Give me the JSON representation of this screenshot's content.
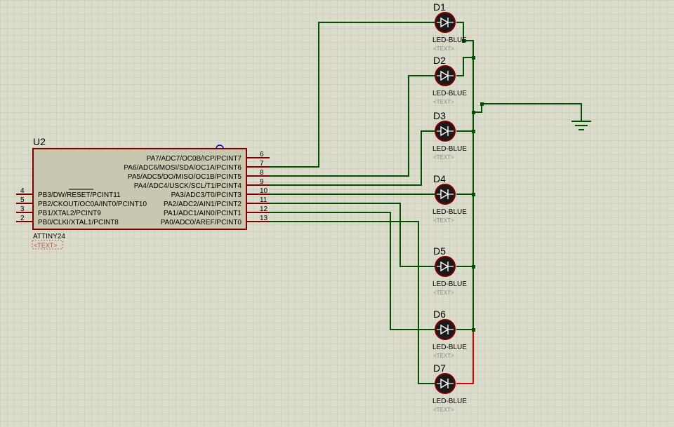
{
  "chip": {
    "ref": "U2",
    "part": "ATTINY24",
    "text": "<TEXT>",
    "right_pins": [
      {
        "label": "PA7/ADC7/OC0B/ICP/PCINT7",
        "num": "6"
      },
      {
        "label": "PA6/ADC6/MOSI/SDA/OC1A/PCINT6",
        "num": "7"
      },
      {
        "label": "PA5/ADC5/DO/MISO/OC1B/PCINT5",
        "num": "8"
      },
      {
        "label": "PA4/ADC4/USCK/SCL/T1/PCINT4",
        "num": "9"
      },
      {
        "label": "PA3/ADC3/T0/PCINT3",
        "num": "10"
      },
      {
        "label": "PA2/ADC2/AIN1/PCINT2",
        "num": "11"
      },
      {
        "label": "PA1/ADC1/AIN0/PCINT1",
        "num": "12"
      },
      {
        "label": "PA0/ADC0/AREF/PCINT0",
        "num": "13"
      }
    ],
    "left_pins": [
      {
        "label": "PB3/DW/RESET/PCINT11",
        "num": "4"
      },
      {
        "label": "PB2/CKOUT/OC0A/INT0/PCINT10",
        "num": "5"
      },
      {
        "label": "PB1/XTAL2/PCINT9",
        "num": "3"
      },
      {
        "label": "PB0/CLKI/XTAL1/PCINT8",
        "num": "2"
      }
    ]
  },
  "leds": [
    {
      "ref": "D1",
      "value": "LED-BLUE",
      "text": "<TEXT>"
    },
    {
      "ref": "D2",
      "value": "LED-BLUE",
      "text": "<TEXT>"
    },
    {
      "ref": "D3",
      "value": "LED-BLUE",
      "text": "<TEXT>"
    },
    {
      "ref": "D4",
      "value": "LED-BLUE",
      "text": "<TEXT>"
    },
    {
      "ref": "D5",
      "value": "LED-BLUE",
      "text": "<TEXT>"
    },
    {
      "ref": "D6",
      "value": "LED-BLUE",
      "text": "<TEXT>"
    },
    {
      "ref": "D7",
      "value": "LED-BLUE",
      "text": "<TEXT>"
    }
  ],
  "colors": {
    "background": "#dcdccc",
    "grid": "#c4c4b2",
    "wire": "#005000",
    "wire_active": "#e00000",
    "component": "#800000",
    "chip_fill": "#c8c8b0",
    "led_fill": "#1a1a1a"
  }
}
